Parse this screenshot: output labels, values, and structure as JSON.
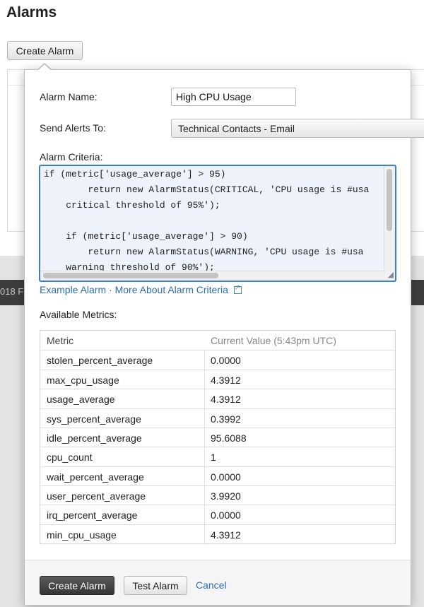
{
  "page": {
    "title": "Alarms",
    "create_button": "Create Alarm",
    "band_text": "018 F"
  },
  "form": {
    "name_label": "Alarm Name:",
    "name_value": "High CPU Usage",
    "alerts_label": "Send Alerts To:",
    "alerts_value": "Technical Contacts - Email",
    "criteria_label": "Alarm Criteria:",
    "criteria_lines": [
      "if (metric['usage_average'] > 95)",
      "        return new AlarmStatus(CRITICAL, 'CPU usage is #usa",
      "    critical threshold of 95%');",
      "",
      "    if (metric['usage_average'] > 90)",
      "        return new AlarmStatus(WARNING, 'CPU usage is #usa",
      "    warning threshold of 90%');"
    ]
  },
  "links": {
    "example": "Example Alarm",
    "separator": "·",
    "more": "More About Alarm Criteria"
  },
  "metrics": {
    "label": "Available Metrics:",
    "headers": [
      "Metric",
      "Current Value (5:43pm UTC)"
    ],
    "rows": [
      [
        "stolen_percent_average",
        "0.0000"
      ],
      [
        "max_cpu_usage",
        "4.3912"
      ],
      [
        "usage_average",
        "4.3912"
      ],
      [
        "sys_percent_average",
        "0.3992"
      ],
      [
        "idle_percent_average",
        "95.6088"
      ],
      [
        "cpu_count",
        "1"
      ],
      [
        "wait_percent_average",
        "0.0000"
      ],
      [
        "user_percent_average",
        "3.9920"
      ],
      [
        "irq_percent_average",
        "0.0000"
      ],
      [
        "min_cpu_usage",
        "4.3912"
      ]
    ]
  },
  "footer": {
    "create_label": "Create Alarm",
    "test_label": "Test Alarm",
    "cancel_label": "Cancel"
  },
  "icons": {
    "external_link": "external-link-icon",
    "resize": "resize-handle-icon"
  },
  "colors": {
    "link": "#2a6db0",
    "focus_border": "#3d7fc8",
    "primary_button": "#3a3a3a"
  }
}
